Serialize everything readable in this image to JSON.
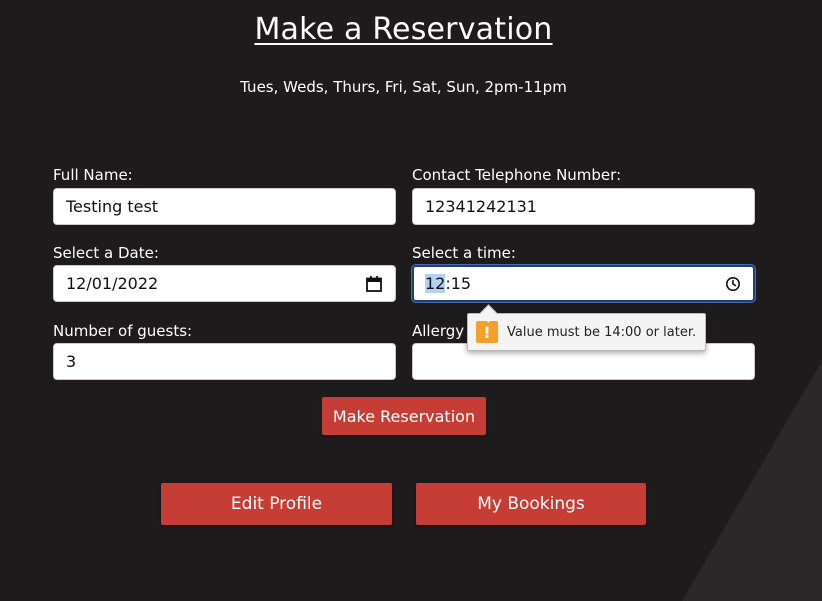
{
  "page": {
    "title": "Make a Reservation",
    "hours": "Tues, Weds, Thurs, Fri, Sat, Sun, 2pm-11pm"
  },
  "form": {
    "full_name": {
      "label": "Full Name:",
      "value": "Testing test"
    },
    "phone": {
      "label": "Contact Telephone Number:",
      "value": "12341242131"
    },
    "date": {
      "label": "Select a Date:",
      "value": "12/01/2022",
      "icon": "calendar-icon"
    },
    "time": {
      "label": "Select a time:",
      "hour": "12",
      "separator": ":",
      "minute": "15",
      "icon": "clock-icon"
    },
    "guests": {
      "label": "Number of guests:",
      "value": "3"
    },
    "allergy": {
      "label": "Allergy Information:",
      "value": ""
    },
    "submit_label": "Make Reservation"
  },
  "validation": {
    "message": "Value must be 14:00 or later.",
    "icon": "warning-icon",
    "icon_glyph": "!"
  },
  "nav": {
    "edit_profile_label": "Edit Profile",
    "my_bookings_label": "My Bookings"
  },
  "colors": {
    "background": "#1d1b1b",
    "button": "#c63d35",
    "warning": "#f3a02d",
    "focus": "#1f3f7a"
  }
}
